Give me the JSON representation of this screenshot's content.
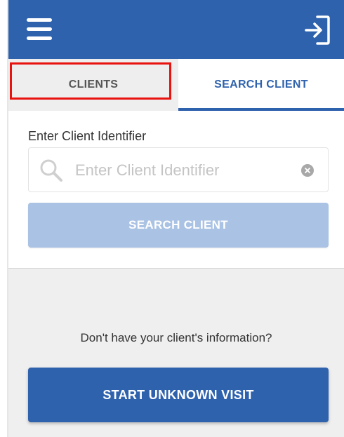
{
  "header": {
    "menu_icon": "hamburger-menu-icon",
    "logout_icon": "logout-icon"
  },
  "tabs": [
    {
      "label": "CLIENTS",
      "active": false
    },
    {
      "label": "SEARCH CLIENT",
      "active": true
    }
  ],
  "search": {
    "label": "Enter Client Identifier",
    "placeholder": "Enter Client Identifier",
    "value": "",
    "button_label": "SEARCH CLIENT"
  },
  "unknown": {
    "question": "Don't have your client's information?",
    "button_label": "START UNKNOWN VISIT"
  },
  "colors": {
    "primary": "#2f62ad",
    "disabled_button": "#aac2e3",
    "highlight": "#e8120f",
    "background": "#efefef"
  }
}
